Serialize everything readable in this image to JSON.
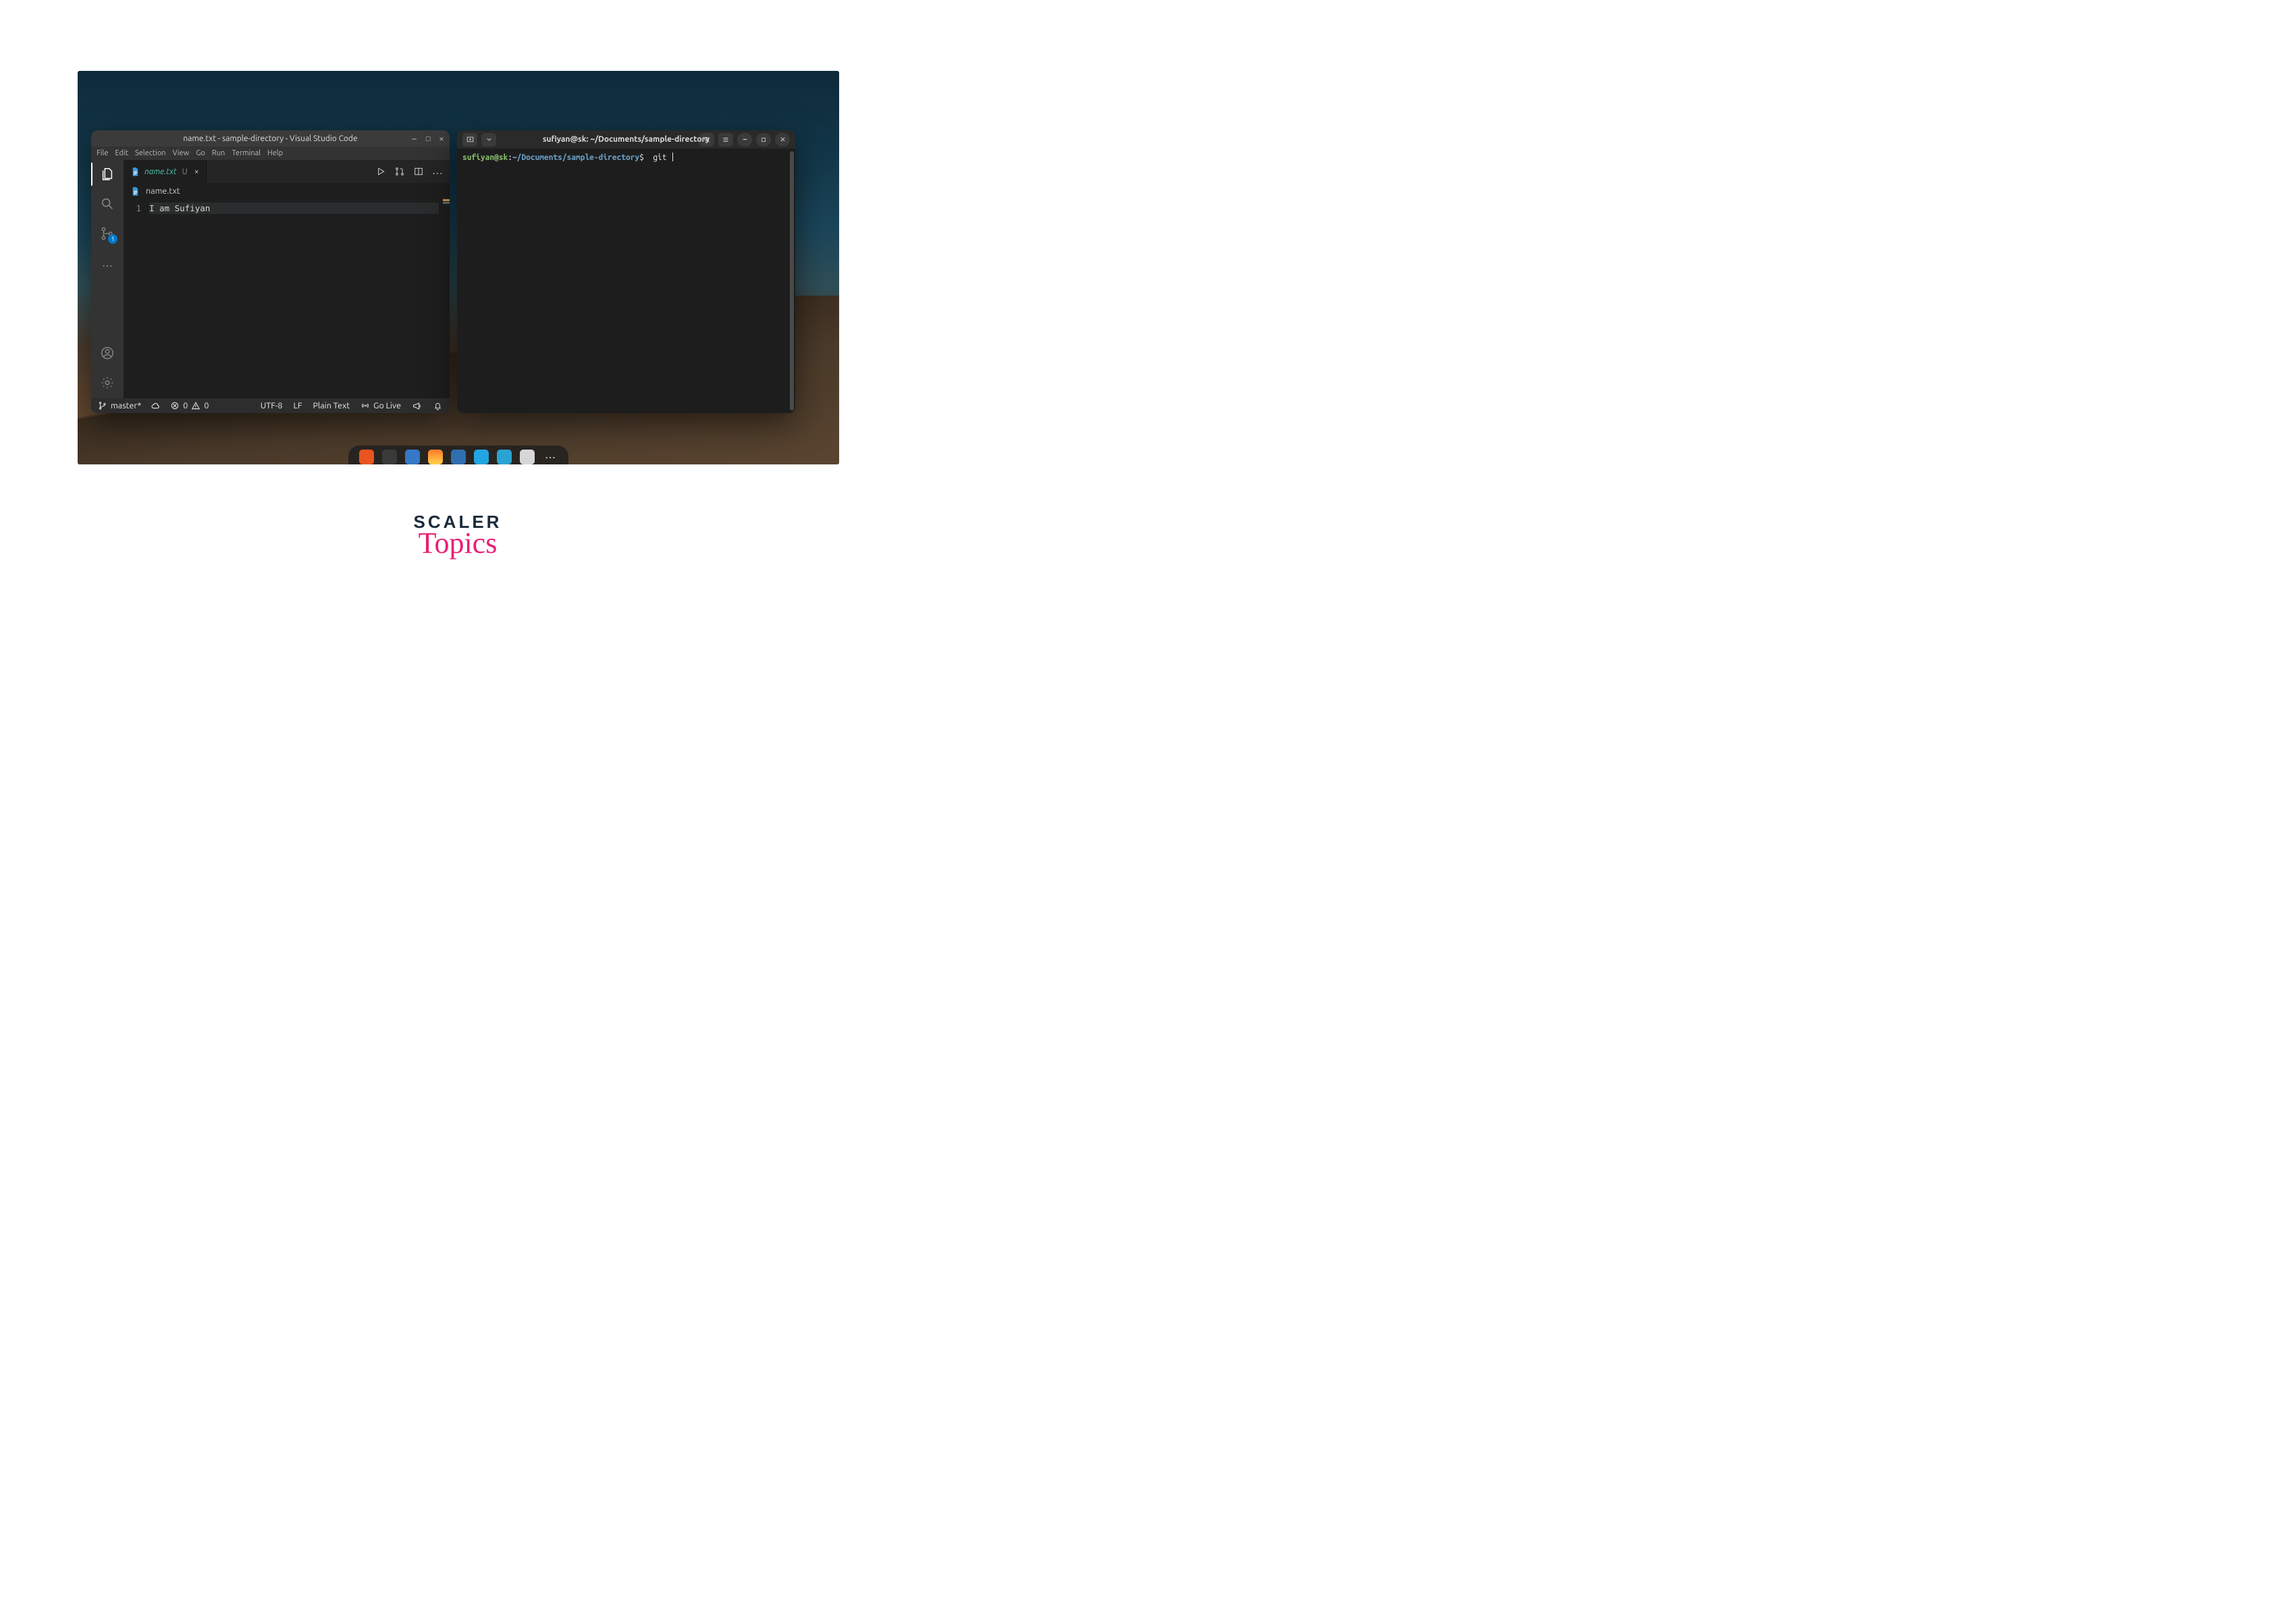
{
  "brand": {
    "line1": "SCALER",
    "line2": "Topics"
  },
  "vscode": {
    "title": "name.txt - sample-directory - Visual Studio Code",
    "menus": [
      "File",
      "Edit",
      "Selection",
      "View",
      "Go",
      "Run",
      "Terminal",
      "Help"
    ],
    "tab": {
      "filename": "name.txt",
      "modified_flag": "U",
      "close": "×"
    },
    "tab_actions": {
      "run": "run-icon",
      "pr": "git-pull-request-icon",
      "split": "split-editor-icon",
      "more": "…"
    },
    "breadcrumbs": {
      "filename": "name.txt"
    },
    "editor": {
      "line_number": "1",
      "content": "I am Sufiyan"
    },
    "activitybar": {
      "explorer": "explorer-icon",
      "search": "search-icon",
      "scm": "source-control-icon",
      "scm_badge": "1",
      "more": "…",
      "account": "account-icon",
      "settings": "settings-gear-icon"
    },
    "status": {
      "branch": "master*",
      "sync": "sync-icon",
      "errors_icon": "error-icon",
      "errors": "0",
      "warnings_icon": "warning-icon",
      "warnings": "0",
      "encoding": "UTF-8",
      "eol": "LF",
      "language": "Plain Text",
      "golive": "Go Live",
      "feedback": "feedback-icon",
      "bell": "bell-icon"
    },
    "window_controls": {
      "min": "–",
      "max": "▢",
      "close": "×"
    }
  },
  "terminal": {
    "title": "sufiyan@sk: ~/Documents/sample-directory",
    "prompt": {
      "user": "sufiyan@sk",
      "sep": ":",
      "path": "~/Documents/sample-directory",
      "dollar": "$"
    },
    "command": "git ",
    "header_buttons": {
      "new_tab": "new-tab-icon",
      "dropdown": "dropdown-icon",
      "search": "search-icon",
      "menu": "hamburger-icon",
      "min": "minimize-icon",
      "max": "maximize-icon",
      "close": "close-icon"
    }
  }
}
